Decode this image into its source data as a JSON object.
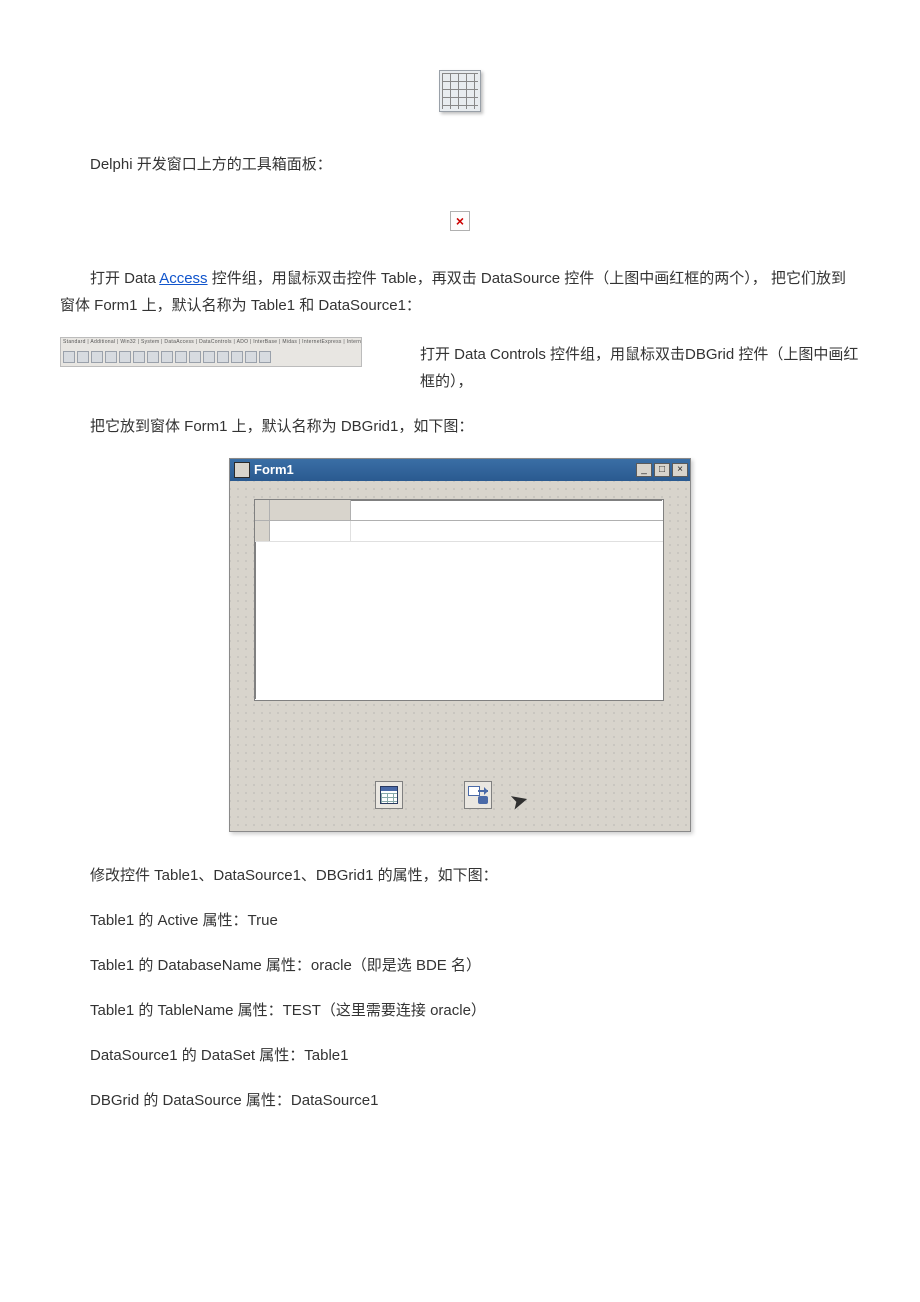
{
  "captions": {
    "toolbox": "Delphi  开发窗口上方的工具箱面板：",
    "para1_a": "打开 Data ",
    "para1_link": "Access",
    "para1_b": " 控件组，用鼠标双击控件 Table，再双击 DataSource 控件（上图中画红框的两个），             把它们放到窗体 Form1 上，默认名称为 Table1 和 DataSource1：",
    "para2": "打开 Data Controls 控件组，用鼠标双击DBGrid 控件（上图中画红框的），",
    "para3": "把它放到窗体 Form1 上，默认名称为 DBGrid1，如下图：",
    "para4": "修改控件 Table1、DataSource1、DBGrid1 的属性，如下图：",
    "prop1": "Table1 的 Active 属性：True",
    "prop2": "Table1 的 DatabaseName 属性：oracle（即是选 BDE 名）",
    "prop3": "Table1 的 TableName 属性：TEST（这里需要连接 oracle）",
    "prop4": "DataSource1 的 DataSet 属性：Table1",
    "prop5": "DBGrid 的 DataSource 属性：DataSource1"
  },
  "broken_placeholder": "×",
  "palette_tabs": "Standard | Additional | Win32 | System | DataAccess | DataControls | ADO | InterBase | Midas | InternetExpress | Internet | FastNet | Decision C…",
  "palette_tab_active": "DataControls",
  "form": {
    "title": "Form1",
    "min": "_",
    "max": "□",
    "close": "×"
  }
}
